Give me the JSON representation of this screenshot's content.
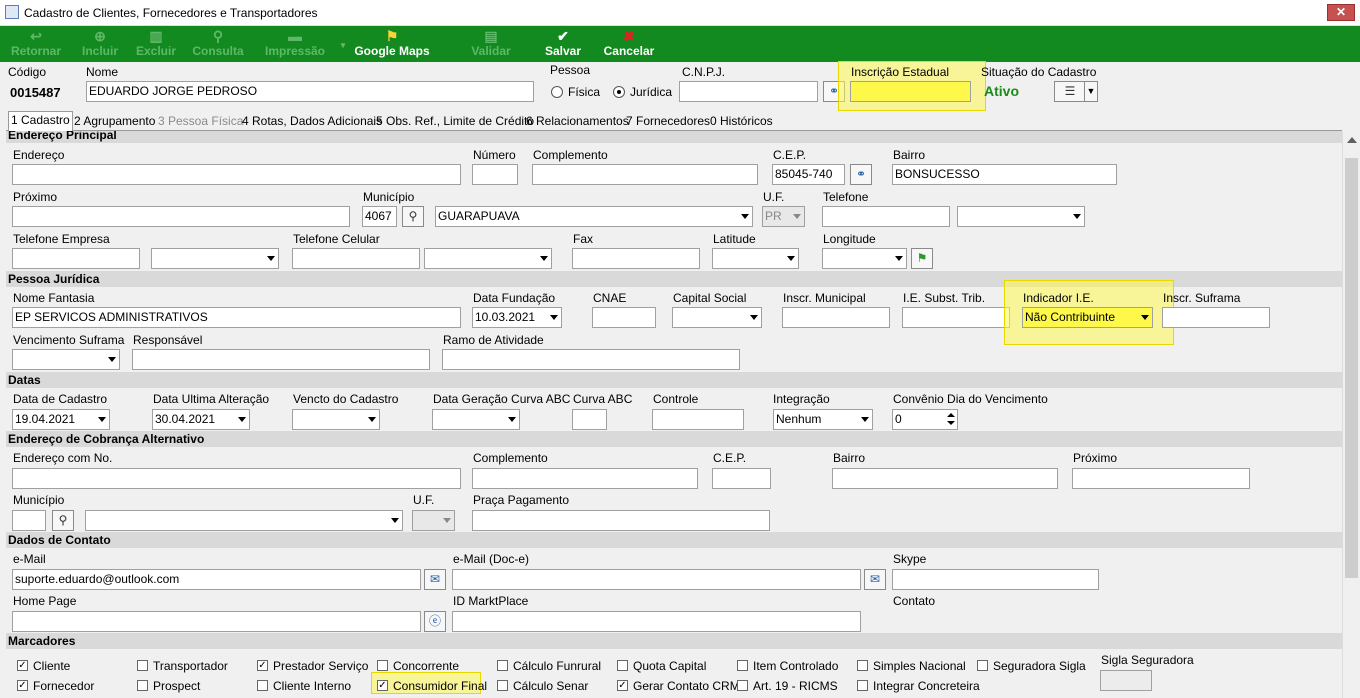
{
  "window": {
    "title": "Cadastro de Clientes, Fornecedores e Transportadores",
    "close": "✕"
  },
  "toolbar": {
    "retornar": "Retornar",
    "incluir": "Incluir",
    "excluir": "Excluir",
    "consulta": "Consulta",
    "impressao": "Impressão",
    "google_maps": "Google Maps",
    "validar": "Validar",
    "salvar": "Salvar",
    "cancelar": "Cancelar",
    "icon_color_enabled": "#ffffff",
    "icon_color_disabled": "#5fb868",
    "cancel_icon_color": "#e02020"
  },
  "header": {
    "codigo_label": "Código",
    "codigo_value": "0015487",
    "nome_label": "Nome",
    "nome_value": "EDUARDO JORGE PEDROSO",
    "pessoa_label": "Pessoa",
    "fisica": "Física",
    "juridica": "Jurídica",
    "cnpj_label": "C.N.P.J.",
    "cnpj_value": "",
    "ie_label": "Inscrição Estadual",
    "ie_value": "",
    "situacao_label": "Situação do Cadastro",
    "situacao_value": "Ativo",
    "situacao_color": "#1a8a1a"
  },
  "tabs": [
    "1 Cadastro",
    "2 Agrupamento",
    "3 Pessoa Física",
    "4 Rotas, Dados Adicionais",
    "5 Obs. Ref., Limite de Crédito",
    "6 Relacionamentos",
    "7 Fornecedores",
    "0 Históricos"
  ],
  "endereco_principal": {
    "section": "Endereço Principal",
    "endereco_label": "Endereço",
    "endereco_value": "",
    "numero_label": "Número",
    "numero_value": "",
    "complemento_label": "Complemento",
    "cep_label": "C.E.P.",
    "cep_value": "85045-740",
    "bairro_label": "Bairro",
    "bairro_value": "BONSUCESSO",
    "proximo_label": "Próximo",
    "municipio_label": "Município",
    "municipio_code": "4067",
    "municipio_value": "GUARAPUAVA",
    "uf_label": "U.F.",
    "uf_value": "PR",
    "telefone_label": "Telefone",
    "telefone_empresa_label": "Telefone Empresa",
    "telefone_celular_label": "Telefone Celular",
    "fax_label": "Fax",
    "latitude_label": "Latitude",
    "latitude_value": "",
    "longitude_label": "Longitude",
    "longitude_value": ""
  },
  "pessoa_juridica": {
    "section": "Pessoa Jurídica",
    "nome_fantasia_label": "Nome Fantasia",
    "nome_fantasia_value": "EP SERVICOS ADMINISTRATIVOS",
    "data_fundacao_label": "Data Fundação",
    "data_fundacao_value": "10.03.2021",
    "cnae_label": "CNAE",
    "cnae_value": "",
    "capital_social_label": "Capital Social",
    "inscr_municipal_label": "Inscr. Municipal",
    "ie_subst_label": "I.E. Subst. Trib.",
    "indicador_ie_label": "Indicador I.E.",
    "indicador_ie_value": "Não Contribuinte",
    "inscr_suframa_label": "Inscr. Suframa",
    "vencimento_suframa_label": "Vencimento Suframa",
    "responsavel_label": "Responsável",
    "ramo_label": "Ramo de Atividade"
  },
  "datas": {
    "section": "Datas",
    "data_cadastro_label": "Data de Cadastro",
    "data_cadastro_value": "19.04.2021",
    "data_ultima_label": "Data Ultima Alteração",
    "data_ultima_value": "30.04.2021",
    "vencto_label": "Vencto do Cadastro",
    "curva_data_label": "Data Geração Curva ABC",
    "curva_label": "Curva ABC",
    "controle_label": "Controle",
    "integracao_label": "Integração",
    "integracao_value": "Nenhum",
    "convenio_label": "Convênio Dia do Vencimento",
    "convenio_value": "0"
  },
  "cobranca": {
    "section": "Endereço de Cobrança Alternativo",
    "endereco_label": "Endereço com No.",
    "complemento_label": "Complemento",
    "cep_label": "C.E.P.",
    "bairro_label": "Bairro",
    "proximo_label": "Próximo",
    "municipio_label": "Município",
    "uf_label": "U.F.",
    "praca_label": "Praça Pagamento"
  },
  "contato": {
    "section": "Dados de Contato",
    "email_label": "e-Mail",
    "email_value": "suporte.eduardo@outlook.com",
    "email_doce_label": "e-Mail (Doc-e)",
    "skype_label": "Skype",
    "homepage_label": "Home Page",
    "marktplace_label": "ID MarktPlace",
    "contato_label": "Contato"
  },
  "marcadores": {
    "section": "Marcadores",
    "sigla_label": "Sigla Seguradora",
    "items": [
      {
        "label": "Cliente",
        "checked": true
      },
      {
        "label": "Transportador",
        "checked": false
      },
      {
        "label": "Prestador Serviço",
        "checked": true
      },
      {
        "label": "Concorrente",
        "checked": false
      },
      {
        "label": "Cálculo Funrural",
        "checked": false
      },
      {
        "label": "Quota Capital",
        "checked": false
      },
      {
        "label": "Item Controlado",
        "checked": false
      },
      {
        "label": "Simples Nacional",
        "checked": false
      },
      {
        "label": "Seguradora Sigla",
        "checked": false
      },
      {
        "label": "Fornecedor",
        "checked": true
      },
      {
        "label": "Prospect",
        "checked": false
      },
      {
        "label": "Cliente Interno",
        "checked": false
      },
      {
        "label": "Consumidor Final",
        "checked": true
      },
      {
        "label": "Cálculo Senar",
        "checked": false
      },
      {
        "label": "Gerar Contato CRM",
        "checked": true
      },
      {
        "label": "Art. 19 - RICMS",
        "checked": false
      },
      {
        "label": "Integrar Concreteira",
        "checked": false
      }
    ]
  },
  "highlight_color": "#fdf84a"
}
